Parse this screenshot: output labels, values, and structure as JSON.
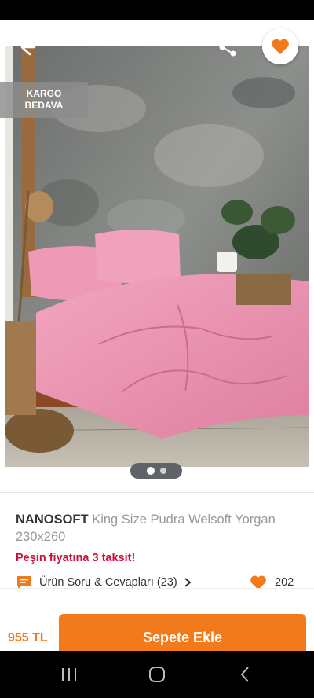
{
  "colors": {
    "accent": "#f27a1a",
    "installment": "#d0103a",
    "badge_bg": "#8c8c8c"
  },
  "hero": {
    "badge_line1": "KARGO",
    "badge_line2": "BEDAVA",
    "image_alt_icon": "bedroom-photo"
  },
  "product": {
    "brand": "NANOSOFT",
    "name": "King Size Pudra Welsoft Yorgan 230x260",
    "installment_text": "Peşin fiyatına 3 taksit!",
    "qa_label": "Ürün Soru & Cevapları (23)",
    "favorite_count": "202",
    "price": "955 TL"
  },
  "actions": {
    "add_to_cart": "Sepete Ekle"
  },
  "pager": {
    "total": 2,
    "current": 1
  }
}
